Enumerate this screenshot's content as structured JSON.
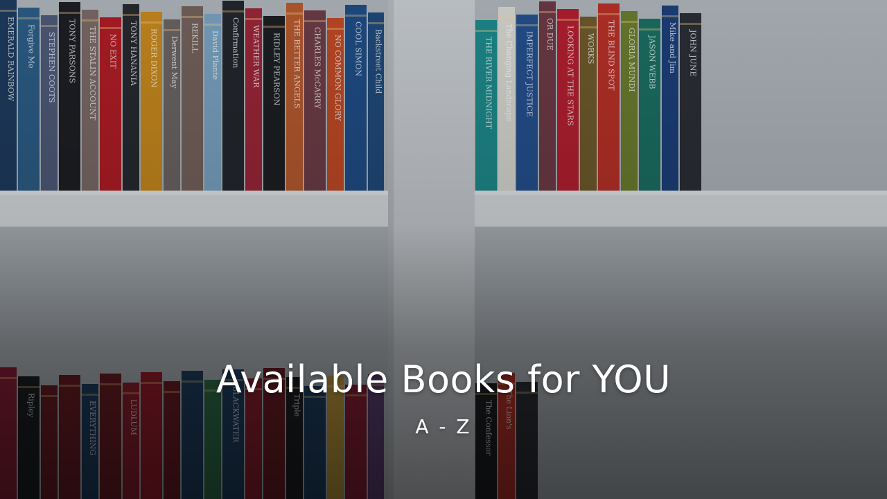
{
  "hero": {
    "title": "Available Books for YOU",
    "subtitle": "A - Z"
  },
  "background": {
    "description_icon": "bookshelf-photo",
    "colors": {
      "shelf": "#d9dde1",
      "wall": "#aeb5bb",
      "divider": "#c7ccd1"
    },
    "top_shelf_books": [
      {
        "color": "#1e3b5e",
        "spine": "EMERALD RAINBOW"
      },
      {
        "color": "#2c5d86",
        "spine": "Forgive Me"
      },
      {
        "color": "#4e5a79",
        "spine": "STEPHEN COOTS"
      },
      {
        "color": "#1d1f24",
        "spine": "TONY PARSONS"
      },
      {
        "color": "#7a6a66",
        "spine": "THE STALIN ACCOUNT"
      },
      {
        "color": "#b01d25",
        "spine": "NO EXIT"
      },
      {
        "color": "#262a2f",
        "spine": "TONY HANANIA"
      },
      {
        "color": "#c7891e",
        "spine": "ROGER DIXON"
      },
      {
        "color": "#6b6562",
        "spine": "Derwent May"
      },
      {
        "color": "#74625c",
        "spine": "REKILL"
      },
      {
        "color": "#7aa3c2",
        "spine": "David Plante"
      },
      {
        "color": "#23272d",
        "spine": "Confirmation"
      },
      {
        "color": "#9b2638",
        "spine": "WEATHER WAR"
      },
      {
        "color": "#1c1f22",
        "spine": "RIDLEY PEARSON"
      },
      {
        "color": "#b65a2f",
        "spine": "THE BETTER ANGELS"
      },
      {
        "color": "#6d3d47",
        "spine": "CHARLES McCARRY"
      },
      {
        "color": "#c04a25",
        "spine": "NO COMMON GLORY"
      },
      {
        "color": "#1f4d86",
        "spine": "COOL SIMON"
      },
      {
        "color": "#204a7a",
        "spine": "Backstreet Child"
      },
      {
        "color": "#1e8a8c",
        "spine": "THE RIVER MIDNIGHT"
      },
      {
        "color": "#d8d8d2",
        "spine": "The Changing Landscape"
      },
      {
        "color": "#24508e",
        "spine": "IMPERFECT JUSTICE"
      },
      {
        "color": "#6d3a45",
        "spine": "OR DUE"
      },
      {
        "color": "#b31f30",
        "spine": "LOOKING AT THE STARS"
      },
      {
        "color": "#6f5a2c",
        "spine": "WORKS"
      },
      {
        "color": "#b73128",
        "spine": "THE BLIND SPOT"
      },
      {
        "color": "#6b7d2f",
        "spine": "GLORIA MUNDI"
      },
      {
        "color": "#1b6f63",
        "spine": "JASON WEBB"
      },
      {
        "color": "#1c3f7a",
        "spine": "Mike and Jim"
      },
      {
        "color": "#2b2f36",
        "spine": "JOHN JUNE"
      }
    ],
    "bottom_shelf_books": [
      {
        "color": "#8a1f36",
        "spine": ""
      },
      {
        "color": "#1d1f22",
        "spine": "Ripley"
      },
      {
        "color": "#6b1d23",
        "spine": ""
      },
      {
        "color": "#6b1d23",
        "spine": ""
      },
      {
        "color": "#1f3f62",
        "spine": "EVERYTHING"
      },
      {
        "color": "#6b1d23",
        "spine": ""
      },
      {
        "color": "#8f1f2e",
        "spine": "LUDLUM"
      },
      {
        "color": "#9a1d2c",
        "spine": ""
      },
      {
        "color": "#6b1d23",
        "spine": ""
      },
      {
        "color": "#1f3f62",
        "spine": ""
      },
      {
        "color": "#2f6f4b",
        "spine": ""
      },
      {
        "color": "#1f3f62",
        "spine": "BLACKWATER"
      },
      {
        "color": "#8f1f2e",
        "spine": ""
      },
      {
        "color": "#6b1d23",
        "spine": ""
      },
      {
        "color": "#1d1f22",
        "spine": "Triple"
      },
      {
        "color": "#1f3f62",
        "spine": ""
      },
      {
        "color": "#c09a3c",
        "spine": ""
      },
      {
        "color": "#8a1f36",
        "spine": ""
      },
      {
        "color": "#5d3f73",
        "spine": ""
      },
      {
        "color": "#1d1f22",
        "spine": "The Confessor"
      },
      {
        "color": "#b73128",
        "spine": "The Lion's"
      },
      {
        "color": "#2b2f36",
        "spine": ""
      }
    ]
  }
}
